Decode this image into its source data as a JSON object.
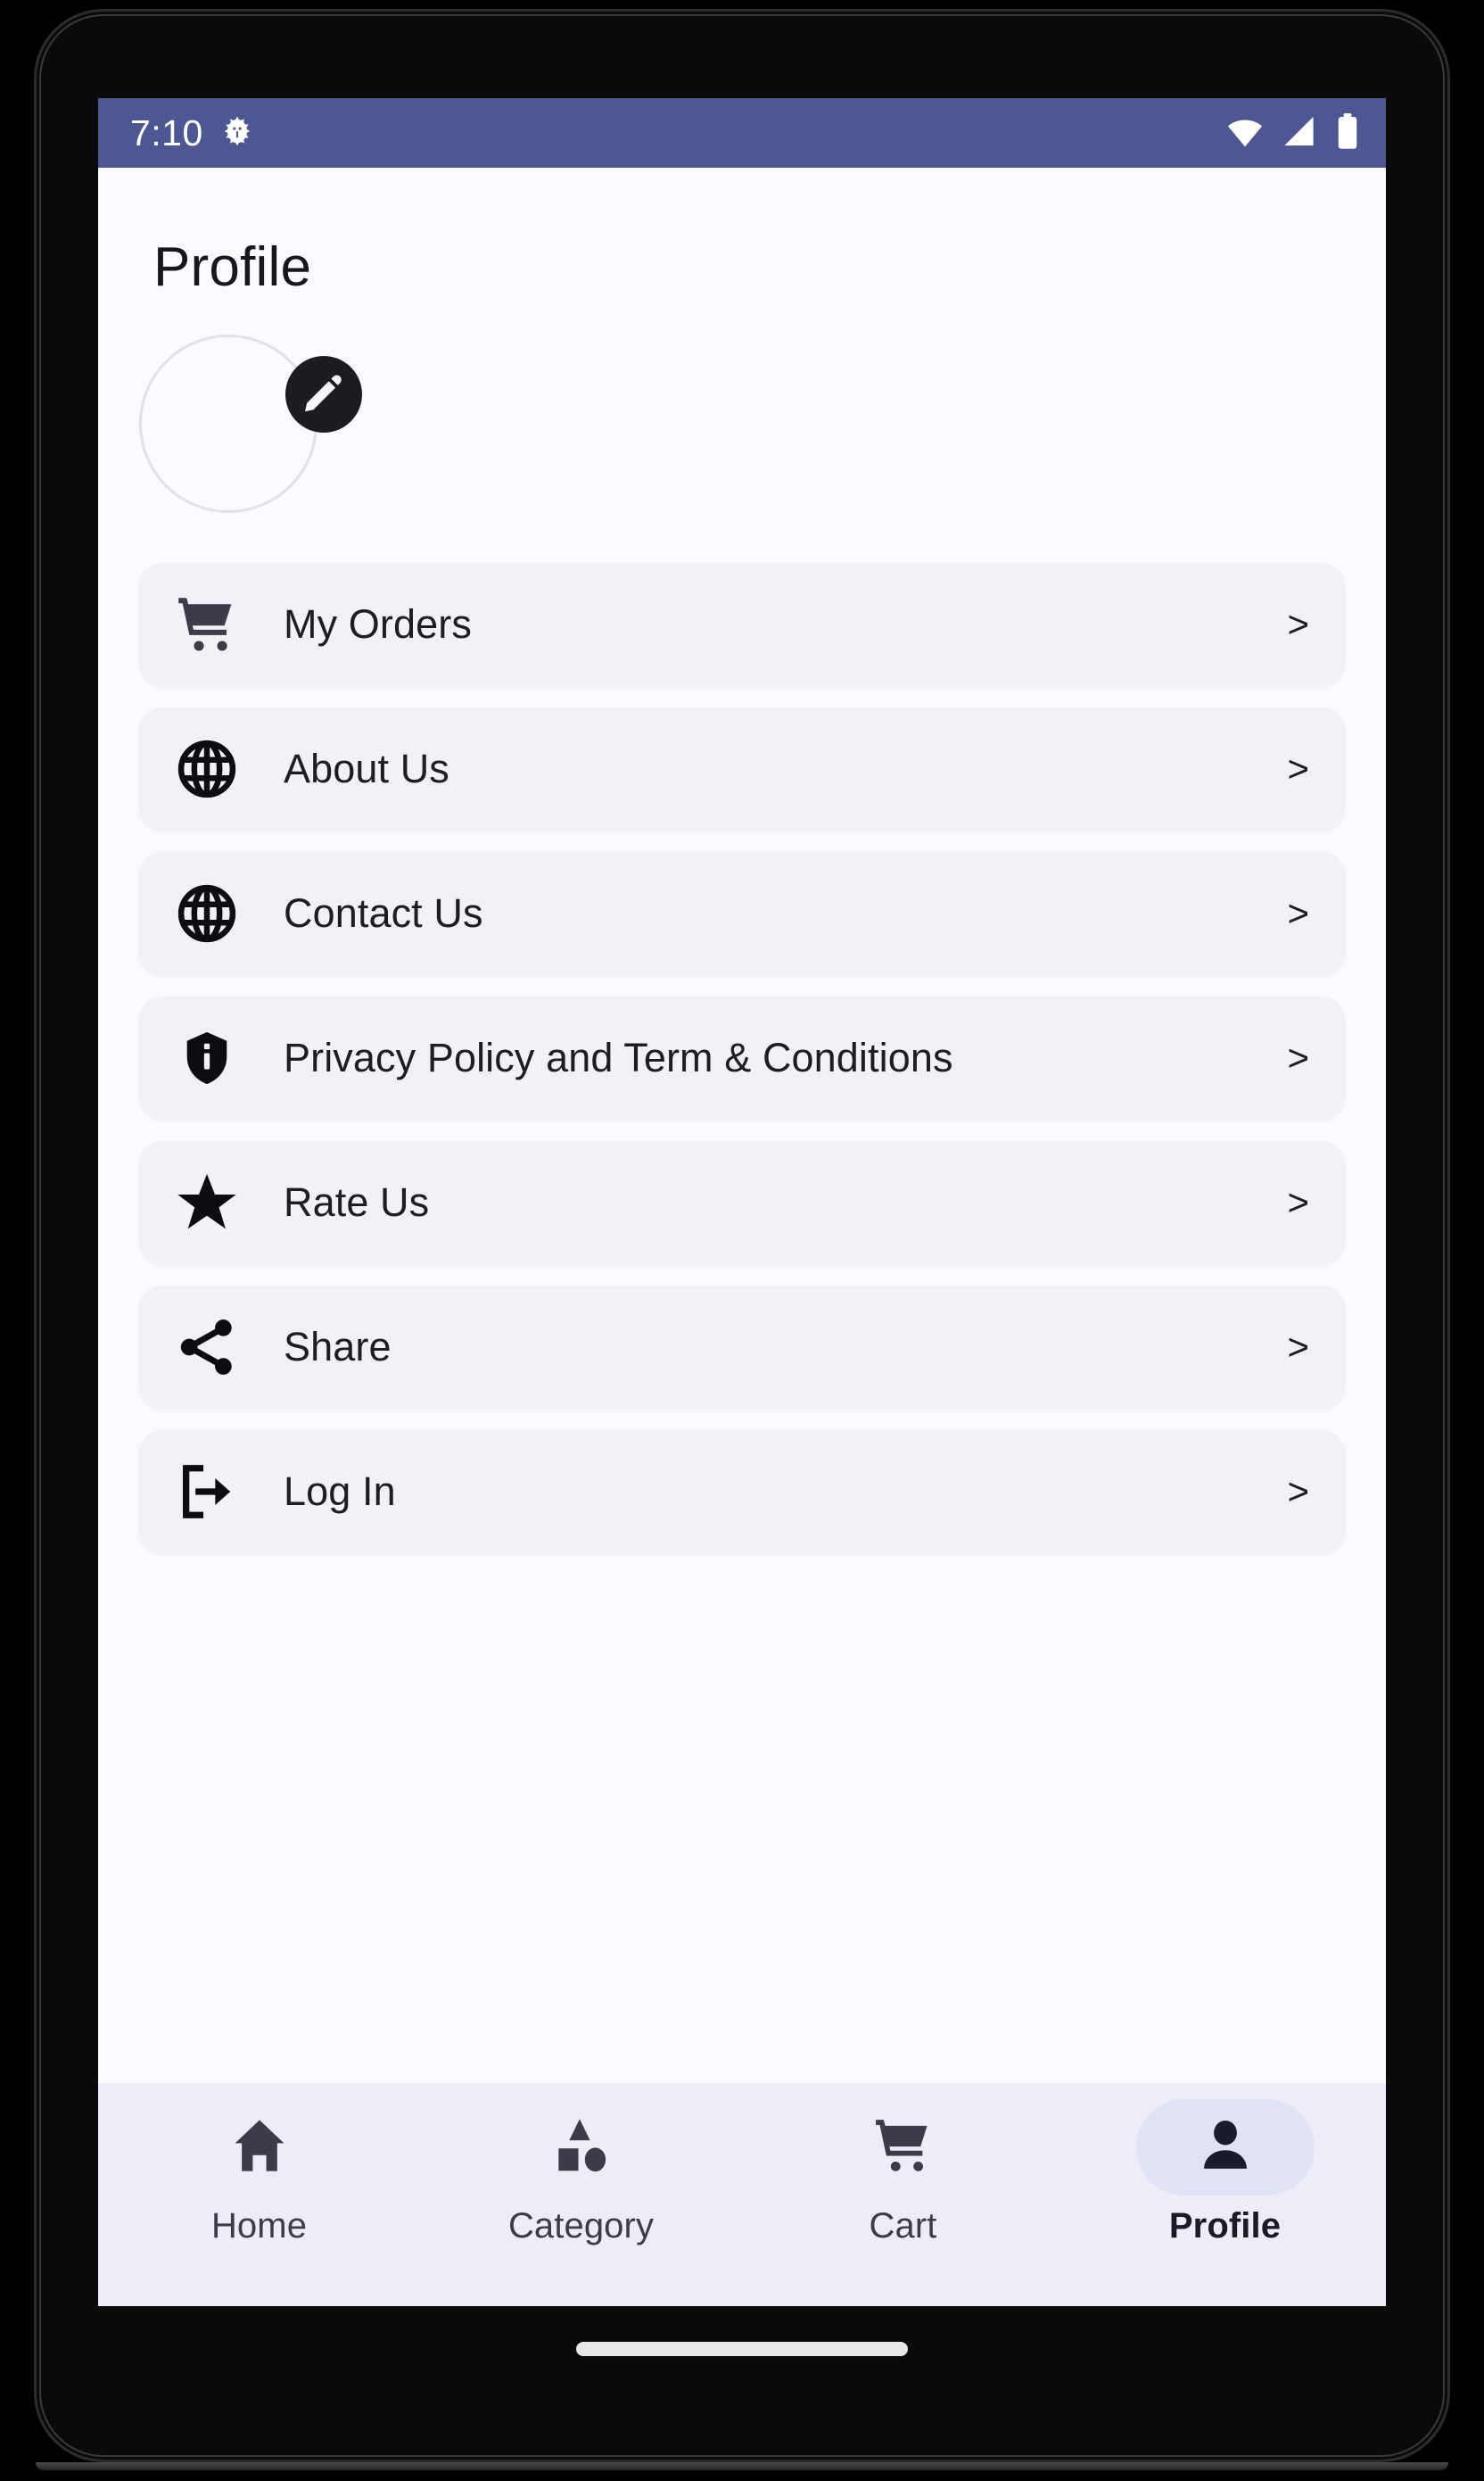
{
  "status_bar": {
    "time": "7:10",
    "icons": [
      "bug-icon",
      "wifi-icon",
      "cellular-signal-icon",
      "battery-icon"
    ],
    "background_color": "#4d5791",
    "foreground_color": "#ffffff"
  },
  "header": {
    "title": "Profile"
  },
  "avatar": {
    "image_placeholder": "",
    "edit_badge_icon": "pencil-icon"
  },
  "menu": {
    "items": [
      {
        "label": "My Orders",
        "icon": "shopping-cart-icon",
        "chevron": ">"
      },
      {
        "label": "About Us",
        "icon": "globe-icon",
        "chevron": ">"
      },
      {
        "label": "Contact Us",
        "icon": "globe-icon",
        "chevron": ">"
      },
      {
        "label": "Privacy Policy and Term & Conditions",
        "icon": "shield-info-icon",
        "chevron": ">"
      },
      {
        "label": "Rate Us",
        "icon": "star-icon",
        "chevron": ">"
      },
      {
        "label": "Share",
        "icon": "share-nodes-icon",
        "chevron": ">"
      },
      {
        "label": "Log In",
        "icon": "logout-icon",
        "chevron": ">"
      }
    ]
  },
  "bottom_nav": {
    "items": [
      {
        "label": "Home",
        "icon": "home-icon",
        "active": false
      },
      {
        "label": "Category",
        "icon": "shapes-icon",
        "active": false
      },
      {
        "label": "Cart",
        "icon": "shopping-cart-icon",
        "active": false
      },
      {
        "label": "Profile",
        "icon": "person-icon",
        "active": true
      }
    ],
    "background_color": "#eeedf7",
    "active_pill_color": "#e0e2f6"
  },
  "colors": {
    "screen_background": "#fbfaff",
    "card_background": "#f2f1f7",
    "text_primary": "#1d1e24",
    "icon_dark": "#17181c"
  }
}
